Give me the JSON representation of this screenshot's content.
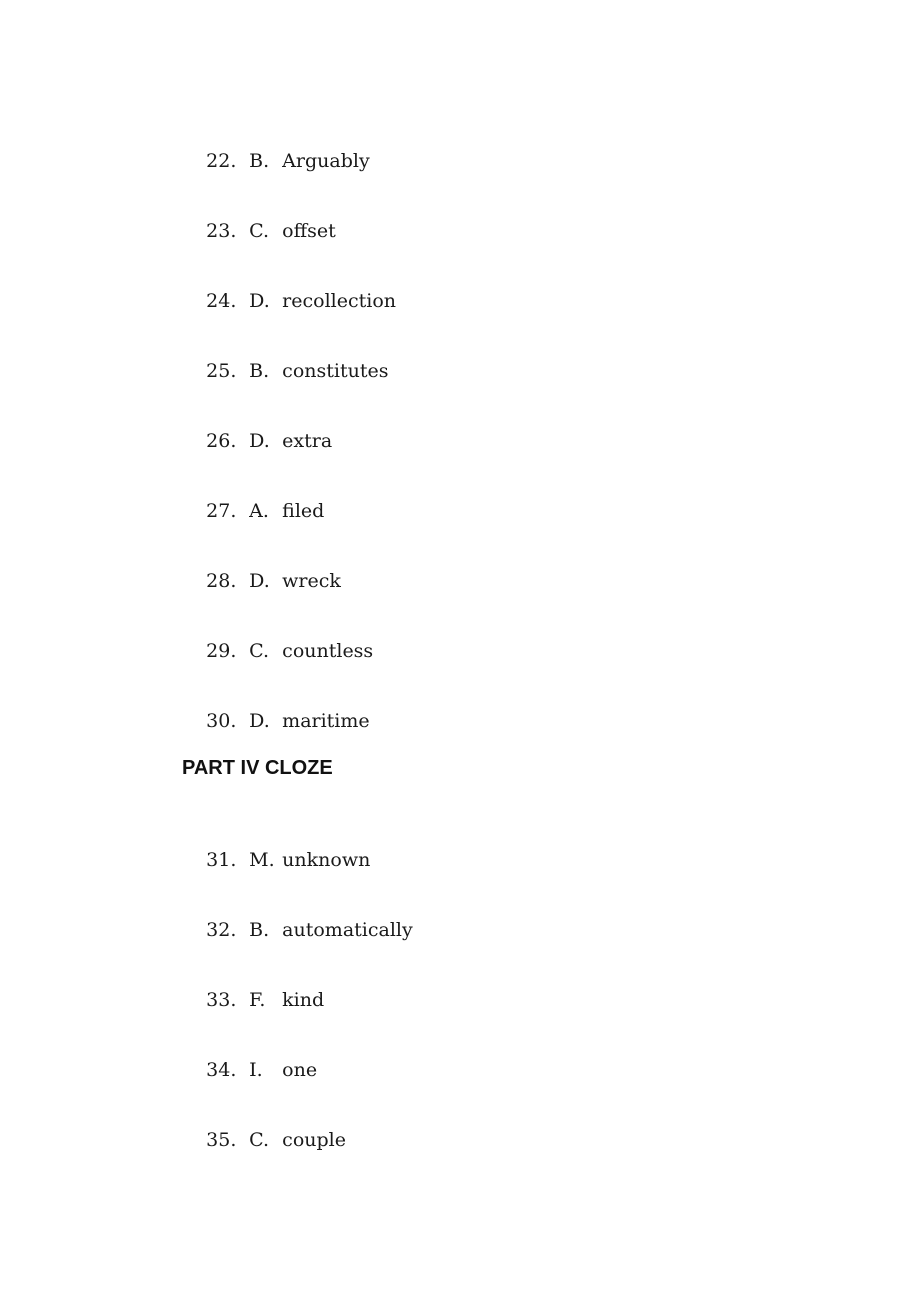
{
  "document": {
    "answers_part3": [
      {
        "number": "22.",
        "option": "B.",
        "word": "Arguably"
      },
      {
        "number": "23.",
        "option": "C.",
        "word": "offset"
      },
      {
        "number": "24.",
        "option": "D.",
        "word": "recollection"
      },
      {
        "number": "25.",
        "option": "B.",
        "word": "constitutes"
      },
      {
        "number": "26.",
        "option": "D.",
        "word": "extra"
      },
      {
        "number": "27.",
        "option": "A.",
        "word": "filed"
      },
      {
        "number": "28.",
        "option": "D.",
        "word": "wreck"
      },
      {
        "number": "29.",
        "option": "C.",
        "word": "countless"
      },
      {
        "number": "30.",
        "option": "D.",
        "word": "maritime"
      }
    ],
    "section_heading": "PART IV CLOZE",
    "answers_part4": [
      {
        "number": "31.",
        "option": "M.",
        "word": "unknown"
      },
      {
        "number": "32.",
        "option": "B.",
        "word": "automatically"
      },
      {
        "number": "33.",
        "option": "F.",
        "word": "kind"
      },
      {
        "number": "34.",
        "option": "I.",
        "word": "one"
      },
      {
        "number": "35.",
        "option": "C.",
        "word": "couple"
      }
    ]
  }
}
